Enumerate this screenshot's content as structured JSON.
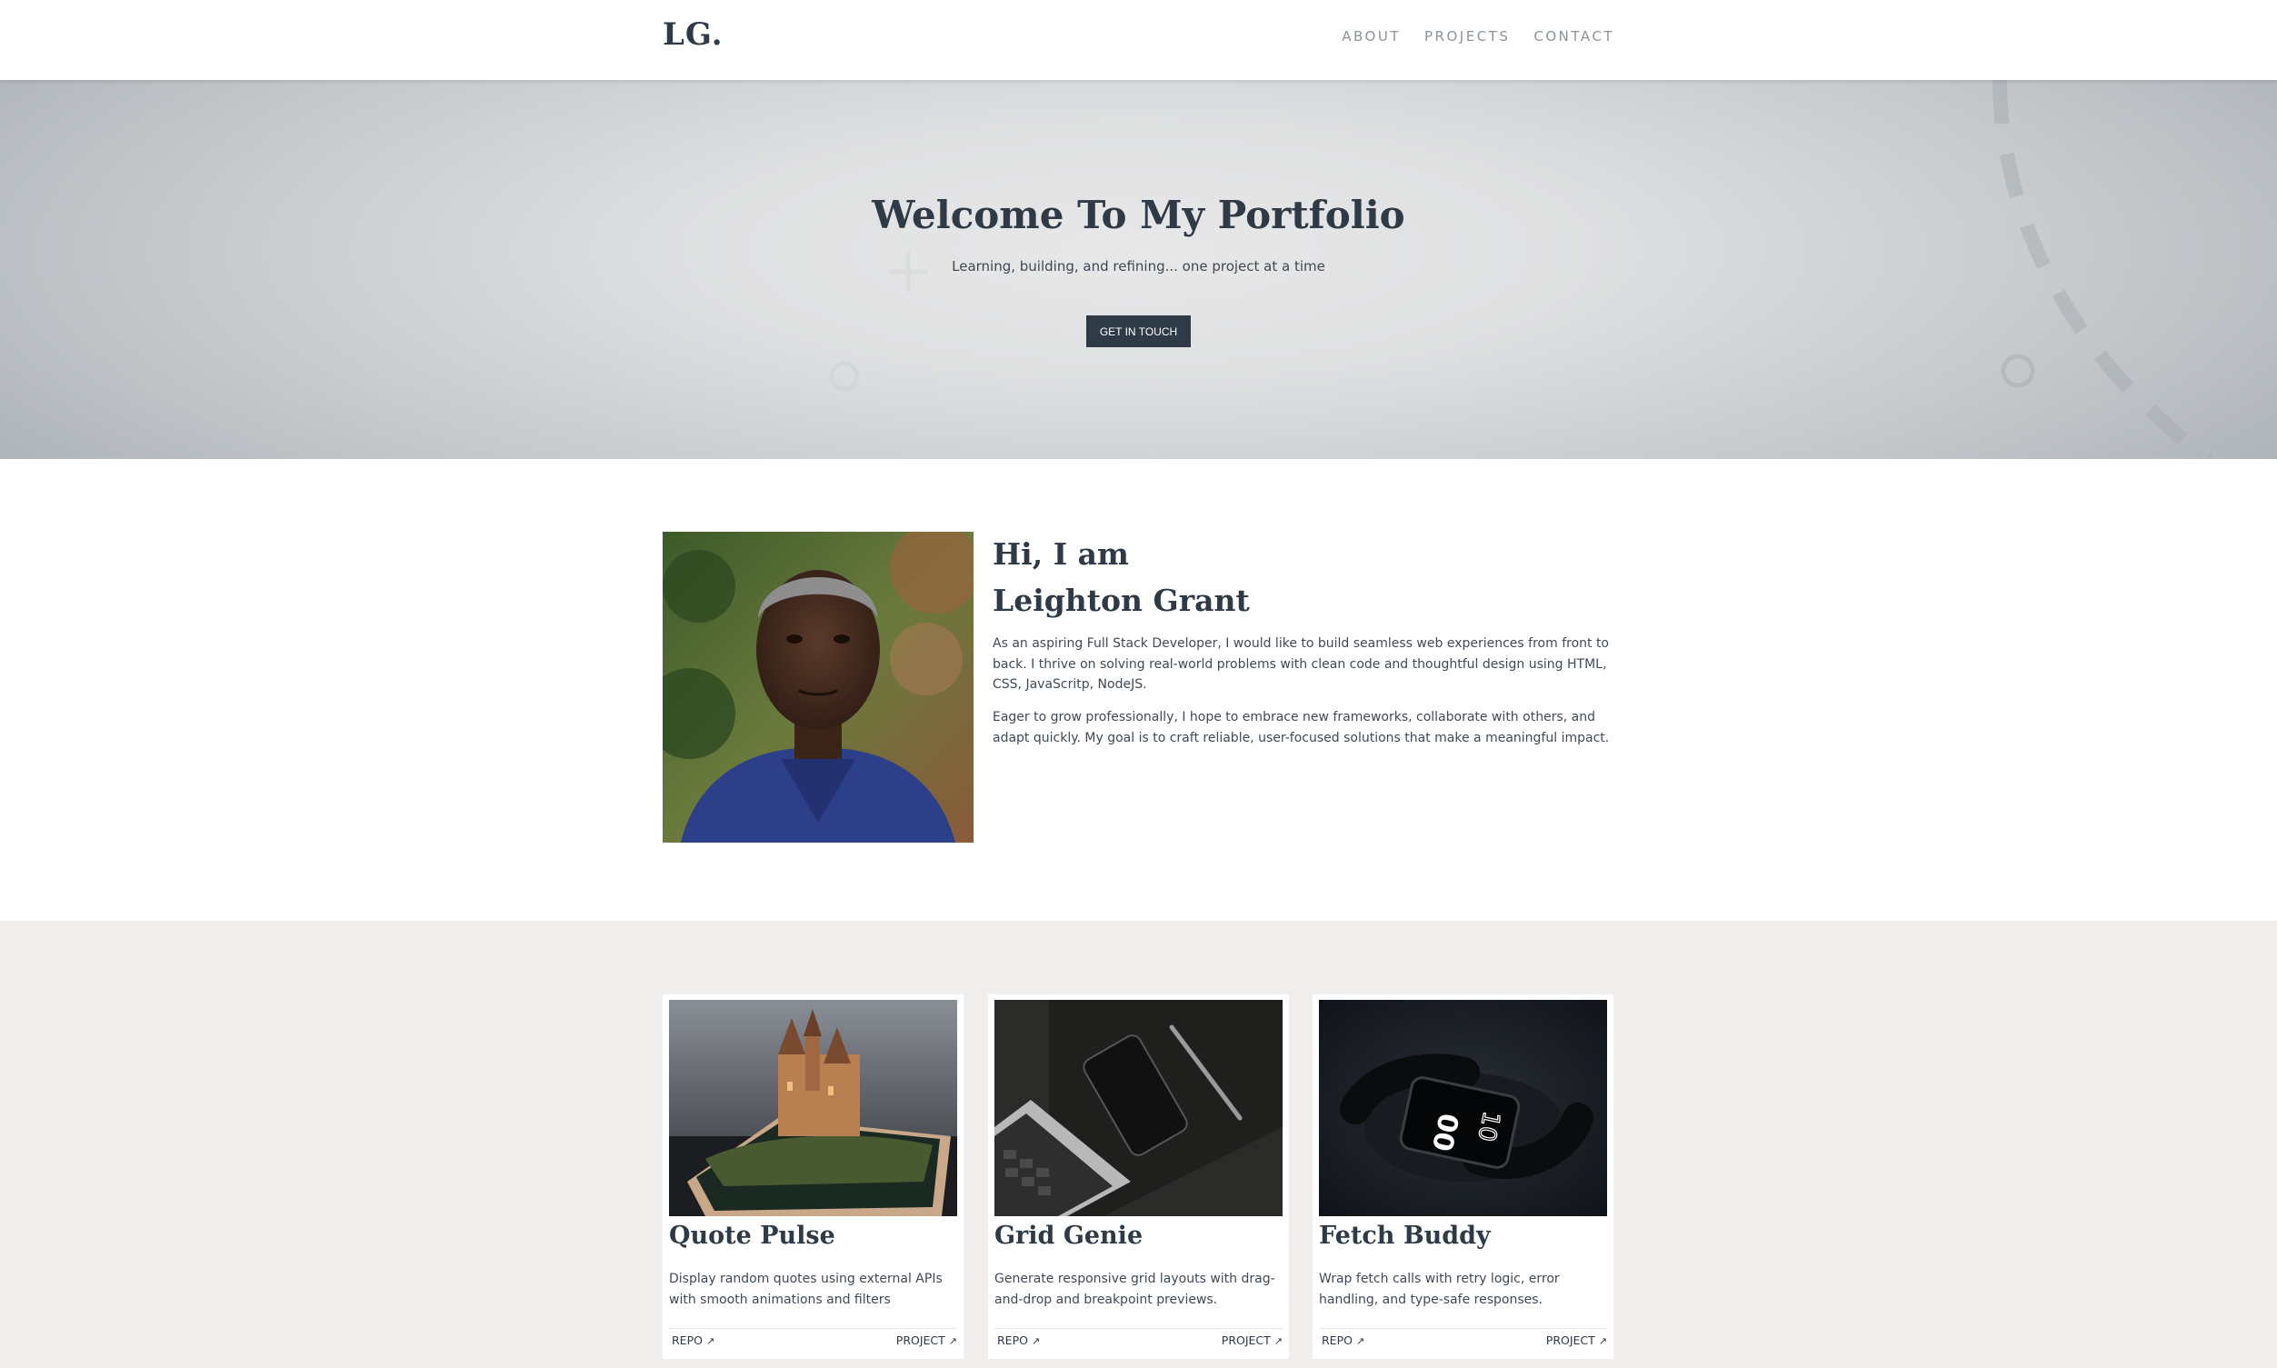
{
  "nav": {
    "logo": "LG.",
    "links": [
      "ABOUT",
      "PROJECTS",
      "CONTACT"
    ]
  },
  "hero": {
    "title": "Welcome To My Portfolio",
    "subtitle": "Learning, building, and refining... one project at a time",
    "cta": "GET IN TOUCH"
  },
  "about": {
    "greeting": "Hi, I am",
    "name": "Leighton Grant",
    "paragraphs": [
      "As an aspiring Full Stack Developer, I would like to build seamless web experiences from front to back. I thrive on solving real-world problems with clean code and thoughtful design using HTML, CSS, JavaScritp, NodeJS.",
      "Eager to grow professionally, I hope to embrace new frameworks, collaborate with others, and adapt quickly. My goal is to craft reliable, user-focused solutions that make a meaningful impact."
    ]
  },
  "projects": [
    {
      "title": "Quote Pulse",
      "description": "Display random quotes using external APIs with smooth animations and filters",
      "repo_label": "REPO",
      "project_label": "PROJECT"
    },
    {
      "title": "Grid Genie",
      "description": "Generate responsive grid layouts with drag-and-drop and breakpoint previews.",
      "repo_label": "REPO",
      "project_label": "PROJECT"
    },
    {
      "title": "Fetch Buddy",
      "description": "Wrap fetch calls with retry logic, error handling, and type-safe responses.",
      "repo_label": "REPO",
      "project_label": "PROJECT"
    }
  ],
  "icons": {
    "external_link": "↗"
  },
  "colors": {
    "primary": "#2f3a47",
    "projects_bg": "#efeeec",
    "nav_link": "#8b939b"
  }
}
